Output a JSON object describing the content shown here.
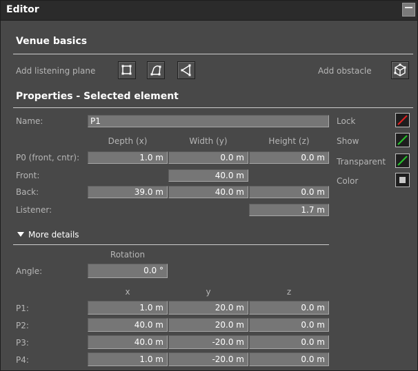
{
  "window": {
    "title": "Editor"
  },
  "venue": {
    "heading": "Venue basics",
    "add_plane_label": "Add listening plane",
    "add_obstacle_label": "Add obstacle"
  },
  "properties": {
    "heading": "Properties - Selected element",
    "name_label": "Name:",
    "name_value": "P1",
    "col_depth": "Depth (x)",
    "col_width": "Width (y)",
    "col_height": "Height (z)",
    "p0_label": "P0 (front, cntr):",
    "p0": [
      "1.0 m",
      "0.0 m",
      "0.0 m"
    ],
    "front_label": "Front:",
    "front_width": "40.0 m",
    "back_label": "Back:",
    "back": [
      "39.0 m",
      "40.0 m",
      "0.0 m"
    ],
    "listener_label": "Listener:",
    "listener_height": "1.7 m",
    "lock_label": "Lock",
    "show_label": "Show",
    "transparent_label": "Transparent",
    "color_label": "Color",
    "accent_red": "#e02020",
    "accent_green": "#27c22b"
  },
  "details": {
    "toggle_label": "More details",
    "rotation_header": "Rotation",
    "angle_label": "Angle:",
    "angle_value": "0.0 °",
    "col_x": "x",
    "col_y": "y",
    "col_z": "z",
    "points": [
      {
        "label": "P1:",
        "x": "1.0 m",
        "y": "20.0 m",
        "z": "0.0 m"
      },
      {
        "label": "P2:",
        "x": "40.0 m",
        "y": "20.0 m",
        "z": "0.0 m"
      },
      {
        "label": "P3:",
        "x": "40.0 m",
        "y": "-20.0 m",
        "z": "0.0 m"
      },
      {
        "label": "P4:",
        "x": "1.0 m",
        "y": "-20.0 m",
        "z": "0.0 m"
      }
    ]
  }
}
